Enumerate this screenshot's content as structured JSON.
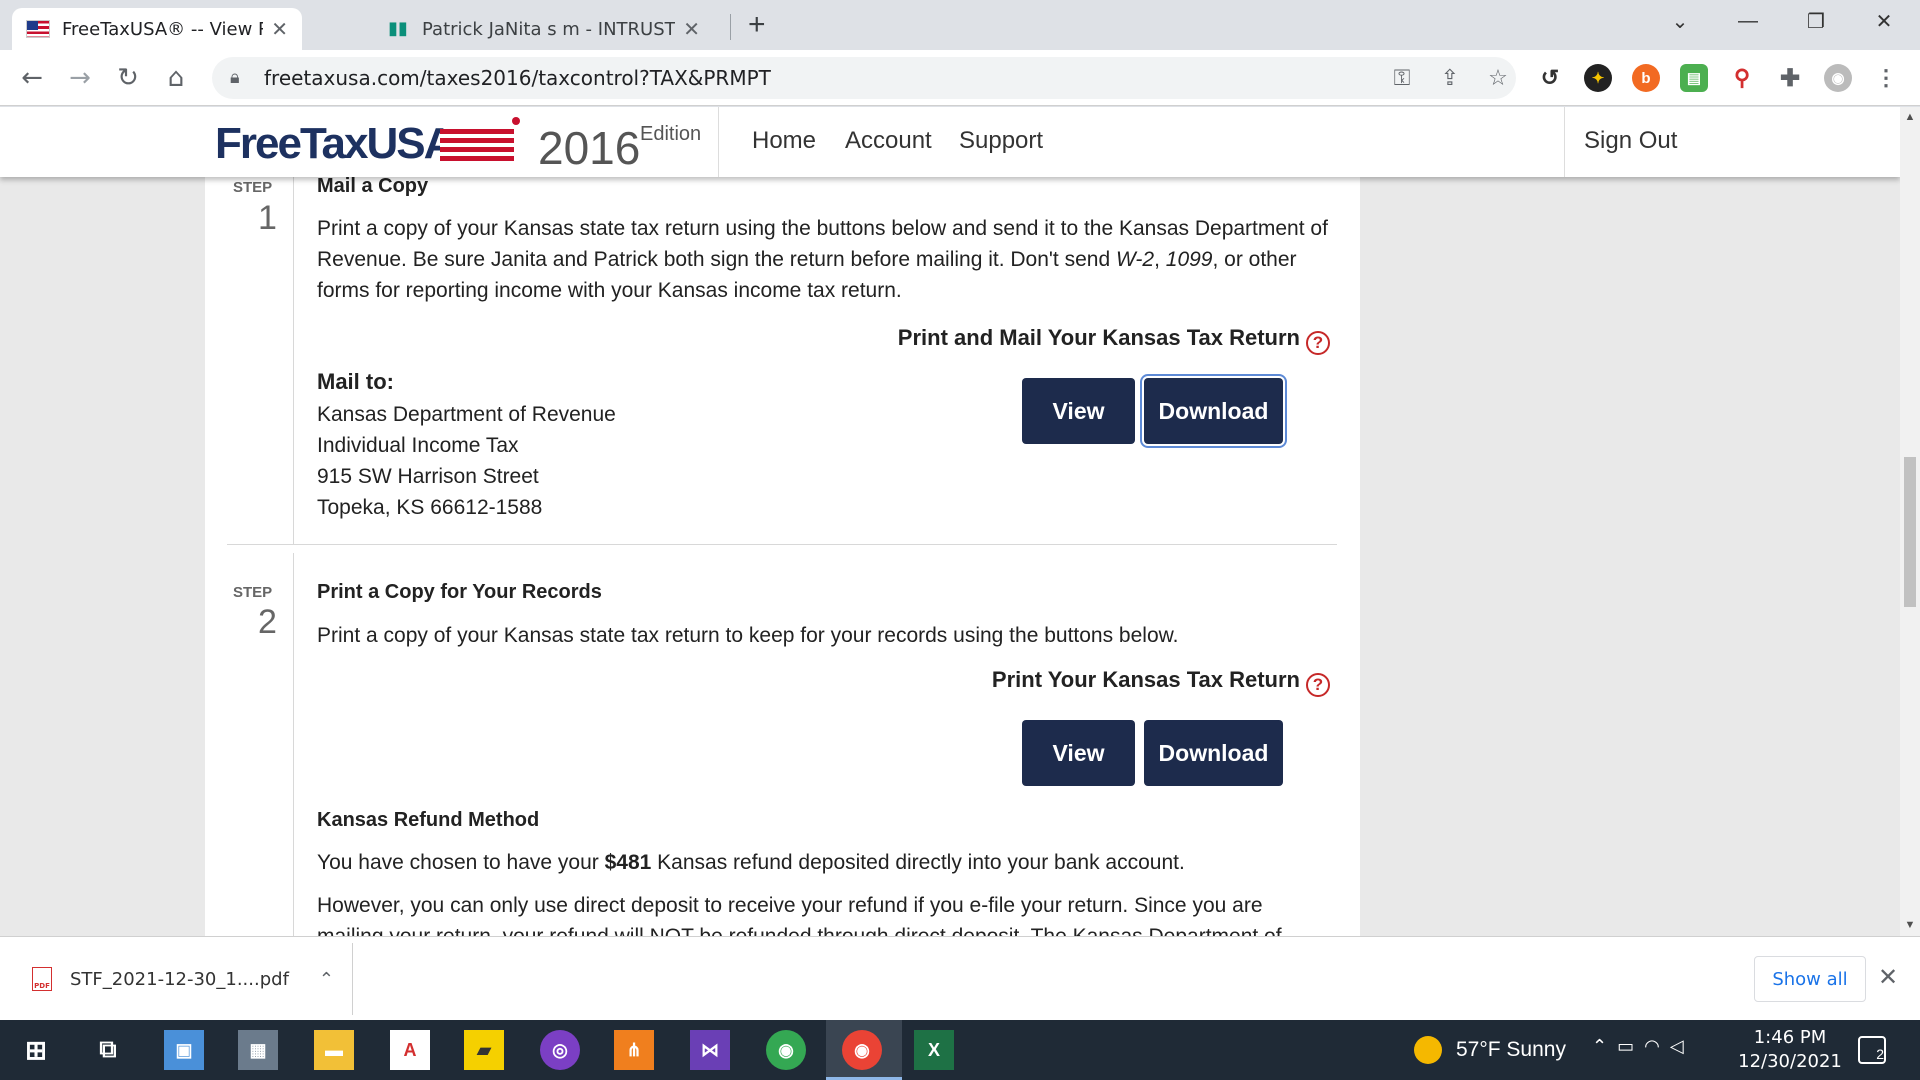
{
  "browser": {
    "tabs": [
      {
        "title": "FreeTaxUSA® -- View Return Stat",
        "icon": "us-flag-icon",
        "active": true
      },
      {
        "title": "Patrick JaNita s m - INTRUST Banl",
        "icon": "intrust-icon",
        "active": false
      }
    ],
    "new_tab": "+",
    "url": "freetaxusa.com/taxes2016/taxcontrol?TAX&PRMPT"
  },
  "site": {
    "logo_text": "FreeTaxUSA",
    "year": "2016",
    "edition": "Edition",
    "nav": [
      "Home",
      "Account",
      "Support"
    ],
    "sign_out": "Sign Out"
  },
  "step1": {
    "label": "STEP",
    "number": "1",
    "title": "Mail a Copy",
    "body_pre": "Print a copy of your Kansas state tax return using the buttons below and send it to the Kansas Department of Revenue. Be sure Janita and Patrick both sign the return before mailing it. Don't send ",
    "form1": "W-2",
    "sep1": ", ",
    "form2": "1099",
    "body_post": ", or other forms for reporting income with your Kansas income tax return.",
    "print_heading": "Print and Mail Your Kansas Tax Return",
    "mail_to_label": "Mail to:",
    "address": [
      "Kansas Department of Revenue",
      "Individual Income Tax",
      "915 SW Harrison Street",
      "Topeka, KS  66612-1588"
    ],
    "view": "View",
    "download": "Download"
  },
  "step2": {
    "label": "STEP",
    "number": "2",
    "title": "Print a Copy for Your Records",
    "body": "Print a copy of your Kansas state tax return to keep for your records using the buttons below.",
    "print_heading": "Print Your Kansas Tax Return",
    "view": "View",
    "download": "Download"
  },
  "refund": {
    "title": "Kansas Refund Method",
    "line1_pre": "You have chosen to have your ",
    "amount": "$481",
    "line1_post": " Kansas refund deposited directly into your bank account.",
    "line2": "However, you can only use direct deposit to receive your refund if you e-file your return. Since you are",
    "line3": "mailing your return, your refund will NOT be refunded through direct deposit. The Kansas Department of"
  },
  "downloads": {
    "file": "STF_2021-12-30_1....pdf",
    "show_all": "Show all"
  },
  "taskbar": {
    "weather": "57°F  Sunny",
    "time": "1:46 PM",
    "date": "12/30/2021",
    "notifications": "2"
  }
}
